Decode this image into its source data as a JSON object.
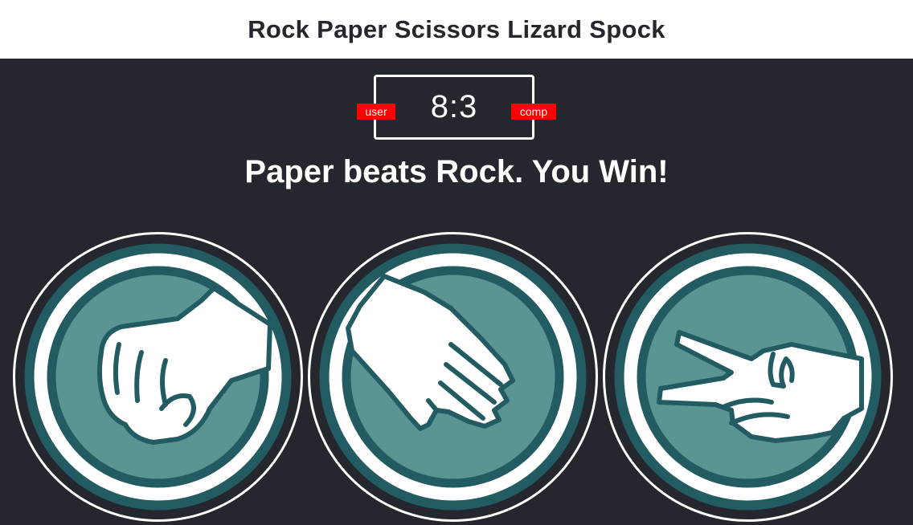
{
  "header": {
    "title": "Rock Paper Scissors Lizard Spock"
  },
  "scoreboard": {
    "user_score": 8,
    "comp_score": 3,
    "score_text": "8:3",
    "user_label": "user",
    "comp_label": "comp"
  },
  "result": {
    "message": "Paper beats Rock. You Win!"
  },
  "choices": [
    {
      "name": "rock",
      "icon": "fist-icon"
    },
    {
      "name": "paper",
      "icon": "open-hand-icon"
    },
    {
      "name": "scissors",
      "icon": "scissors-hand-icon"
    }
  ],
  "colors": {
    "background": "#24272e",
    "header_background": "#ffffff",
    "badge": "#ff0000",
    "ring_dark": "#235b63",
    "disc_fill": "#5a9594",
    "hand": "#ffffff"
  }
}
